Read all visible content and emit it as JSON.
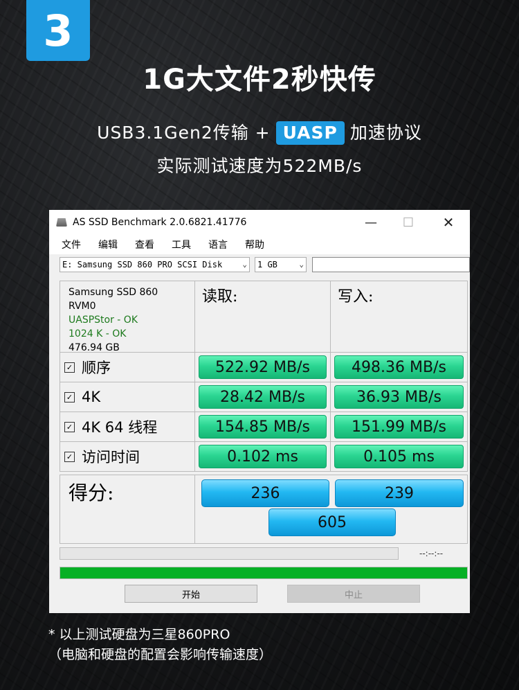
{
  "poster": {
    "step_number": "3",
    "headline": "1G大文件2秒快传",
    "subline_prefix": "USB3.1Gen2传输 +",
    "subline_badge": "UASP",
    "subline_suffix": "加速协议",
    "subline2": "实际测试速度为522MB/s",
    "footnote_line1": "* 以上测试硬盘为三星860PRO",
    "footnote_line2": "（电脑和硬盘的配置会影响传输速度）",
    "accent_color": "#1f9be0"
  },
  "window": {
    "title": "AS SSD Benchmark 2.0.6821.41776",
    "menu": [
      "文件",
      "编辑",
      "查看",
      "工具",
      "语言",
      "帮助"
    ],
    "disk_select": "E: Samsung SSD 860 PRO SCSI Disk",
    "size_select": "1 GB",
    "info": {
      "model": "Samsung SSD 860",
      "firmware": "RVM0",
      "driver_status": "UASPStor - OK",
      "alignment_status": "1024 K - OK",
      "capacity": "476.94 GB"
    },
    "col_read": "读取:",
    "col_write": "写入:",
    "rows": [
      {
        "label": "顺序",
        "read": "522.92 MB/s",
        "write": "498.36 MB/s"
      },
      {
        "label": "4K",
        "read": "28.42 MB/s",
        "write": "36.93 MB/s"
      },
      {
        "label": "4K 64 线程",
        "read": "154.85 MB/s",
        "write": "151.99 MB/s"
      },
      {
        "label": "访问时间",
        "read": "0.102 ms",
        "write": "0.105 ms"
      }
    ],
    "score_label": "得分:",
    "score_read": "236",
    "score_write": "239",
    "score_total": "605",
    "timer": "--:--:--",
    "overall_progress": 1.0,
    "start_button": "开始",
    "stop_button": "中止",
    "colors": {
      "result_green": "#2bd592",
      "score_blue": "#23b8f2",
      "progress_green": "#06b025"
    }
  }
}
